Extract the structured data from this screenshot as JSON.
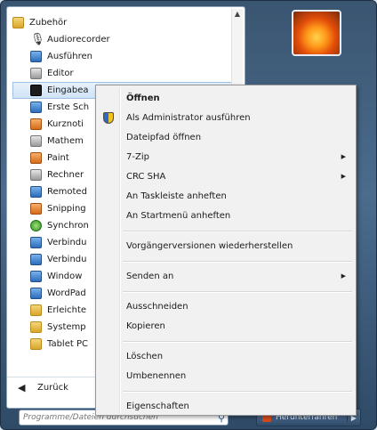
{
  "program_list": [
    {
      "label": "Zubehör",
      "icon": "folder-icon",
      "child": false
    },
    {
      "label": "Audiorecorder",
      "icon": "mic-icon",
      "child": true
    },
    {
      "label": "Ausführen",
      "icon": "run-icon",
      "child": true
    },
    {
      "label": "Editor",
      "icon": "notepad-icon",
      "child": true
    },
    {
      "label": "Eingabea",
      "icon": "cmd-icon",
      "child": true,
      "highlighted": true
    },
    {
      "label": "Erste Sch",
      "icon": "getting-started-icon",
      "child": true
    },
    {
      "label": "Kurznoti",
      "icon": "sticky-notes-icon",
      "child": true
    },
    {
      "label": "Mathem",
      "icon": "math-input-icon",
      "child": true
    },
    {
      "label": "Paint",
      "icon": "paint-icon",
      "child": true
    },
    {
      "label": "Rechner",
      "icon": "calculator-icon",
      "child": true
    },
    {
      "label": "Remoted",
      "icon": "remote-desktop-icon",
      "child": true
    },
    {
      "label": "Snipping",
      "icon": "snipping-tool-icon",
      "child": true
    },
    {
      "label": "Synchron",
      "icon": "sync-center-icon",
      "child": true
    },
    {
      "label": "Verbindu",
      "icon": "network-projector-icon",
      "child": true
    },
    {
      "label": "Verbindu",
      "icon": "connection-icon",
      "child": true
    },
    {
      "label": "Window",
      "icon": "windows-explorer-icon",
      "child": true
    },
    {
      "label": "WordPad",
      "icon": "wordpad-icon",
      "child": true
    },
    {
      "label": "Erleichte",
      "icon": "folder-icon",
      "child": true
    },
    {
      "label": "Systemp",
      "icon": "folder-icon",
      "child": true
    },
    {
      "label": "Tablet PC",
      "icon": "folder-icon",
      "child": true
    }
  ],
  "back": {
    "label": "Zurück"
  },
  "search": {
    "placeholder": "Programme/Dateien durchsuchen"
  },
  "shutdown": {
    "label": "Herunterfahren"
  },
  "context_menu": {
    "items": [
      {
        "label": "Öffnen",
        "bold": true
      },
      {
        "label": "Als Administrator ausführen",
        "shield": true
      },
      {
        "label": "Dateipfad öffnen"
      },
      {
        "label": "7-Zip",
        "submenu": true
      },
      {
        "label": "CRC SHA",
        "submenu": true
      },
      {
        "label": "An Taskleiste anheften"
      },
      {
        "label": "An Startmenü anheften"
      },
      {
        "separator": true
      },
      {
        "label": "Vorgängerversionen wiederherstellen"
      },
      {
        "separator": true
      },
      {
        "label": "Senden an",
        "submenu": true
      },
      {
        "separator": true
      },
      {
        "label": "Ausschneiden"
      },
      {
        "label": "Kopieren"
      },
      {
        "separator": true
      },
      {
        "label": "Löschen"
      },
      {
        "label": "Umbenennen"
      },
      {
        "separator": true
      },
      {
        "label": "Eigenschaften"
      }
    ]
  },
  "colors": {
    "menu_bg": "#f1f1f1",
    "highlight": "#cfe2f7",
    "start_frame": "#3a5570"
  }
}
